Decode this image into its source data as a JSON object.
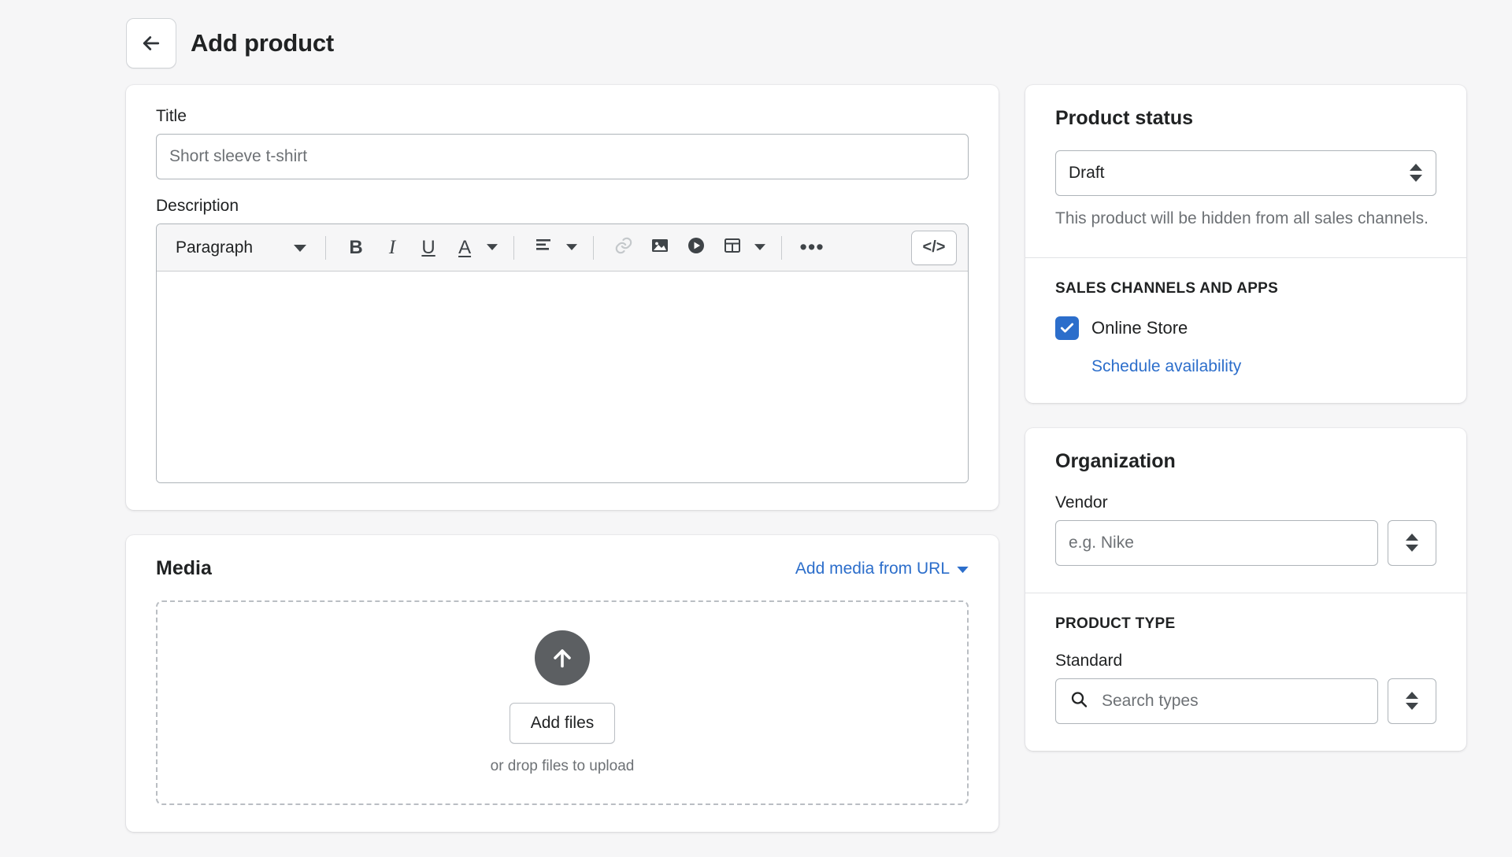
{
  "header": {
    "back_icon": "arrow-left-icon",
    "title": "Add product"
  },
  "main": {
    "title_field": {
      "label": "Title",
      "placeholder": "Short sleeve t-shirt",
      "value": ""
    },
    "description_field": {
      "label": "Description",
      "value": "",
      "toolbar": {
        "block_format": "Paragraph",
        "bold": "B",
        "italic": "I",
        "underline": "U",
        "text_color": "A",
        "dots": "•••",
        "code": "</>"
      }
    },
    "media": {
      "title": "Media",
      "add_from_url": "Add media from URL",
      "add_files_button": "Add files",
      "drop_hint": "or drop files to upload",
      "upload_icon": "upload-arrow-icon"
    }
  },
  "sidebar": {
    "product_status": {
      "title": "Product status",
      "status_value": "Draft",
      "helper": "This product will be hidden from all sales channels."
    },
    "sales_channels": {
      "heading": "SALES CHANNELS AND APPS",
      "channel_label": "Online Store",
      "channel_checked": true,
      "schedule_link": "Schedule availability"
    },
    "organization": {
      "title": "Organization",
      "vendor_label": "Vendor",
      "vendor_placeholder": "e.g. Nike",
      "vendor_value": "",
      "product_type_heading": "PRODUCT TYPE",
      "product_type_standard": "Standard",
      "product_type_placeholder": "Search types",
      "product_type_value": ""
    }
  },
  "colors": {
    "accent": "#2c6ecb",
    "page_bg": "#f6f6f7",
    "text": "#202223",
    "subdued": "#6d7175"
  }
}
